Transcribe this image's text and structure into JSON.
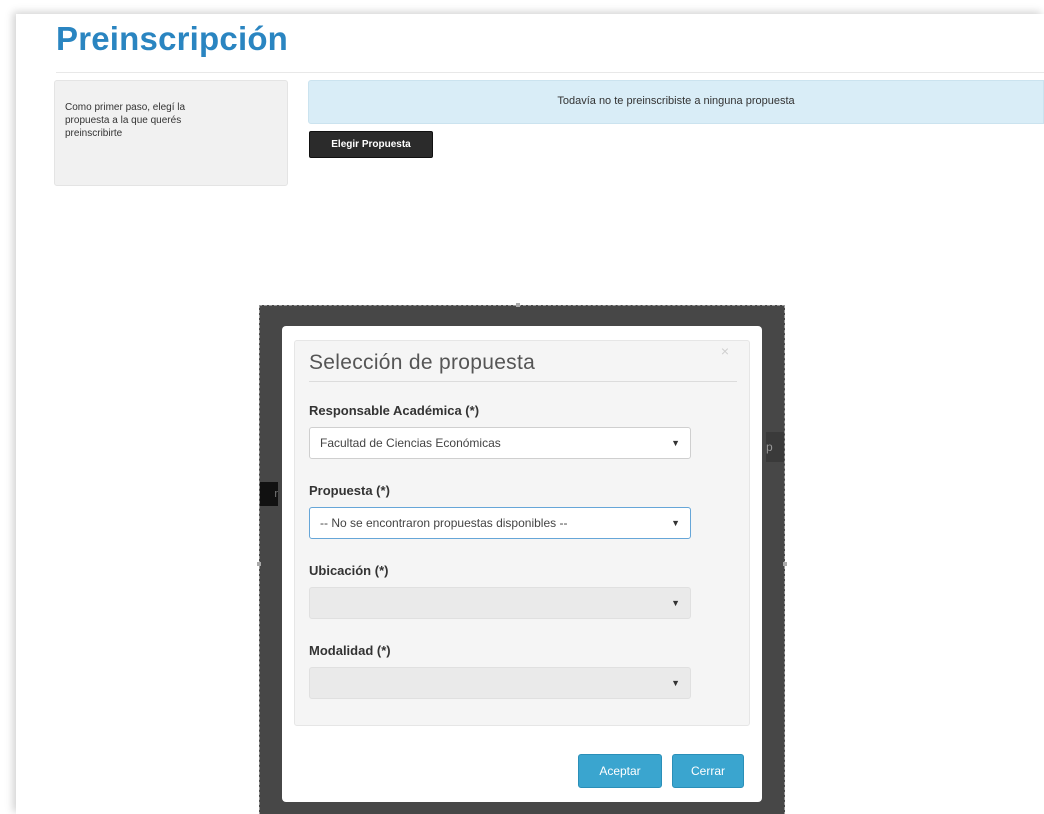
{
  "page": {
    "title": "Preinscripción"
  },
  "info_panel": {
    "text": "Como primer paso, elegí la propuesta a la que querés preinscribirte"
  },
  "alert": {
    "text": "Todavía no te preinscribiste a ninguna propuesta"
  },
  "elegir_button": {
    "label": "Elegir Propuesta"
  },
  "background_peek": {
    "left_text": "r",
    "right_text": "p"
  },
  "modal": {
    "title": "Selección de propuesta",
    "close_glyph": "×",
    "fields": [
      {
        "label": "Responsable Académica (*)",
        "value": "Facultad de Ciencias Económicas",
        "state": "normal"
      },
      {
        "label": "Propuesta (*)",
        "value": "-- No se encontraron propuestas disponibles --",
        "state": "focused"
      },
      {
        "label": "Ubicación (*)",
        "value": "",
        "state": "disabled"
      },
      {
        "label": "Modalidad (*)",
        "value": "",
        "state": "disabled"
      }
    ],
    "caret": "▼",
    "accept_label": "Aceptar",
    "close_label": "Cerrar"
  },
  "colors": {
    "title_blue": "#2a85c1",
    "alert_bg": "#d9edf7",
    "button_dark": "#2b2b2b",
    "modal_button": "#3aa5cf",
    "overlay": "#474747"
  },
  "icons": {
    "dropdown": "chevron-down-icon",
    "close": "close-icon"
  }
}
